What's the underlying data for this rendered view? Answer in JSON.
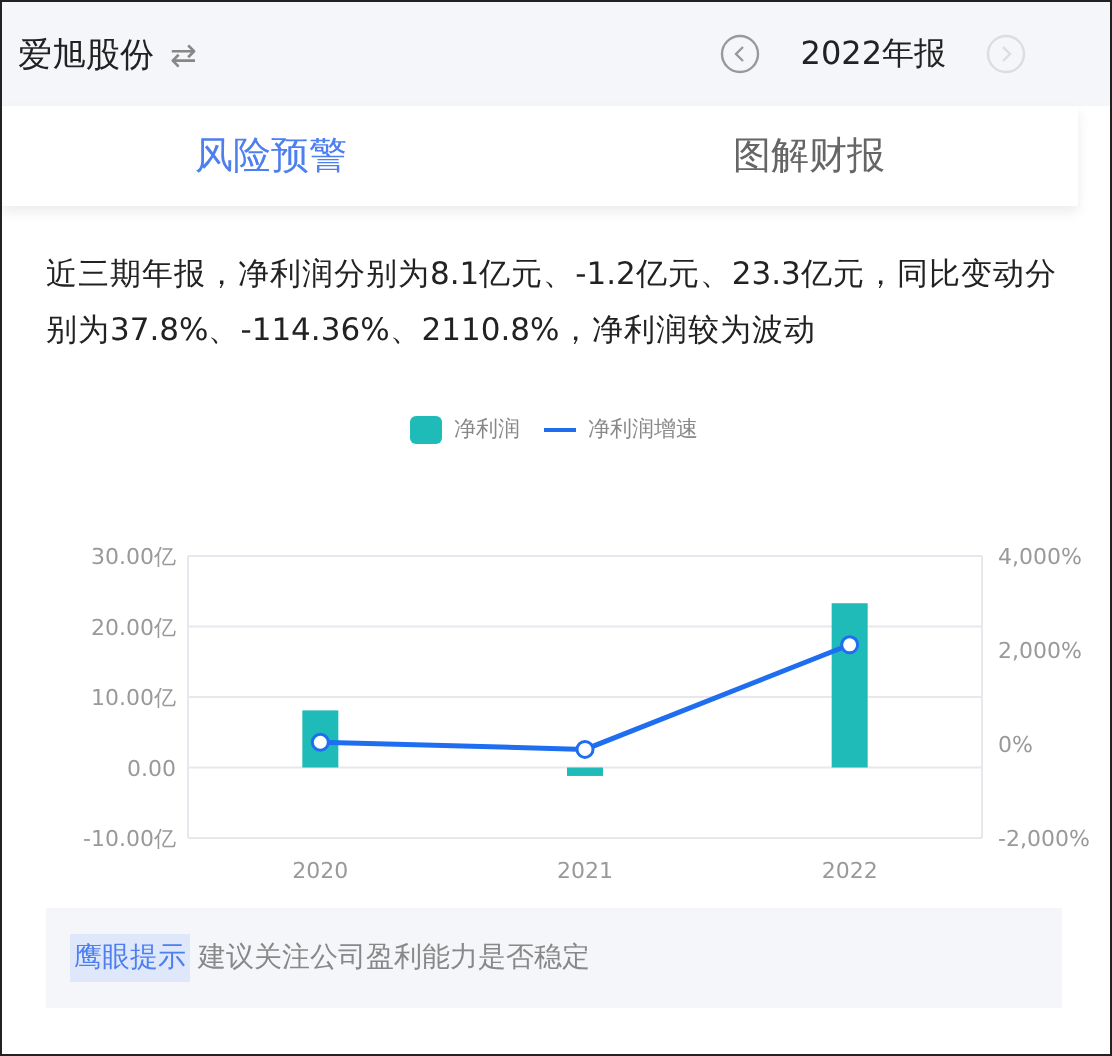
{
  "header": {
    "company": "爱旭股份",
    "swap_icon": "⇄",
    "period": "2022年报",
    "prev_enabled": true,
    "next_enabled": false
  },
  "tabs": [
    {
      "label": "风险预警",
      "selected": true
    },
    {
      "label": "图解财报",
      "selected": false
    }
  ],
  "summary": "近三期年报，净利润分别为8.1亿元、-1.2亿元、23.3亿元，同比变动分别为37.8%、-114.36%、2110.8%，净利润较为波动",
  "chart": {
    "chart_data": {
      "type": "bar",
      "categories": [
        "2020",
        "2021",
        "2022"
      ],
      "series": [
        {
          "name": "净利润",
          "type": "bar",
          "color": "#1fbbb9",
          "values": [
            8.1,
            -1.2,
            23.3
          ]
        },
        {
          "name": "净利润增速",
          "type": "line",
          "color": "#1f6ef0",
          "axis": "y2",
          "marker": "circle",
          "values": [
            37.8,
            -114.4,
            2110.8
          ]
        }
      ],
      "grid": true,
      "ylim": [
        -10,
        30
      ],
      "yticks": [
        {
          "value": 30,
          "label": "30.00亿"
        },
        {
          "value": 20,
          "label": "20.00亿"
        },
        {
          "value": 10,
          "label": "10.00亿"
        },
        {
          "value": 0,
          "label": "0.00"
        },
        {
          "value": -10,
          "label": "-10.00亿"
        }
      ],
      "y2lim": [
        -2000,
        4000
      ],
      "y2ticks": [
        {
          "value": 4000,
          "label": "4,000%"
        },
        {
          "value": 2000,
          "label": "2,000%"
        },
        {
          "value": 0,
          "label": "0%"
        },
        {
          "value": -2000,
          "label": "-2,000%"
        }
      ]
    }
  },
  "tip": {
    "tag": "鹰眼提示",
    "text": "建议关注公司盈利能力是否稳定"
  }
}
